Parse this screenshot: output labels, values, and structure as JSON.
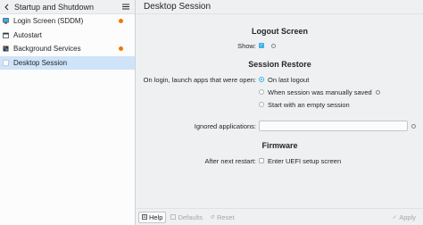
{
  "sidebar": {
    "title": "Startup and Shutdown",
    "items": [
      {
        "label": "Login Screen (SDDM)",
        "icon": "monitor-icon",
        "badge": true
      },
      {
        "label": "Autostart",
        "icon": "calendar-icon",
        "badge": false
      },
      {
        "label": "Background Services",
        "icon": "services-icon",
        "badge": true
      },
      {
        "label": "Desktop Session",
        "icon": "session-icon",
        "badge": false
      }
    ]
  },
  "main": {
    "title": "Desktop Session",
    "logout": {
      "heading": "Logout Screen",
      "show_label": "Show:"
    },
    "restore": {
      "heading": "Session Restore",
      "prompt": "On login, launch apps that were open:",
      "options": [
        "On last logout",
        "When session was manually saved",
        "Start with an empty session"
      ]
    },
    "ignored": {
      "label": "Ignored applications:"
    },
    "firmware": {
      "heading": "Firmware",
      "label": "After next restart:",
      "option": "Enter UEFI setup screen"
    }
  },
  "footer": {
    "help": "Help",
    "defaults": "Defaults",
    "reset": "Reset",
    "apply": "Apply"
  },
  "colors": {
    "accent": "#3daee9",
    "badge": "#f67400",
    "selection": "#cfe4f8"
  }
}
